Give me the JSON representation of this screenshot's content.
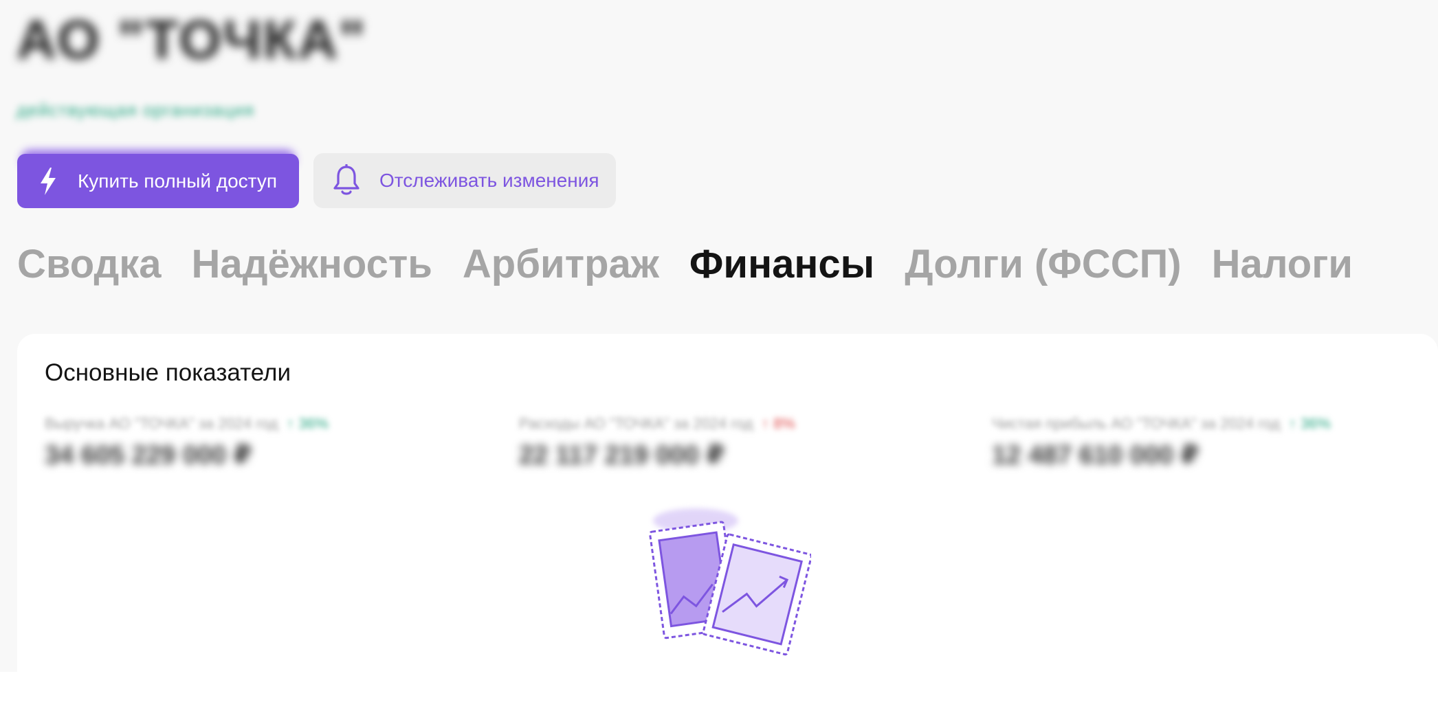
{
  "company": {
    "title": "АО \"ТОЧКА\"",
    "subtitle": "действующая организация"
  },
  "actions": {
    "buy_label": "Купить полный доступ",
    "buy_icon": "lightning-icon",
    "track_label": "Отслеживать изменения",
    "track_icon": "bell-icon"
  },
  "tabs": [
    {
      "label": "Сводка",
      "active": false
    },
    {
      "label": "Надёжность",
      "active": false
    },
    {
      "label": "Арбитраж",
      "active": false
    },
    {
      "label": "Финансы",
      "active": true
    },
    {
      "label": "Долги (ФССП)",
      "active": false
    },
    {
      "label": "Налоги",
      "active": false
    }
  ],
  "main": {
    "title": "Основные показатели",
    "metrics": [
      {
        "label": "Выручка АО \"ТОЧКА\" за 2024 год",
        "delta": "↑ 36%",
        "delta_color": "#2aa884",
        "value": "34 605 229 000 ₽"
      },
      {
        "label": "Расходы АО \"ТОЧКА\" за 2024 год",
        "delta": "↑ 8%",
        "delta_color": "#e05050",
        "value": "22 117 219 000 ₽"
      },
      {
        "label": "Чистая прибыль АО \"ТОЧКА\" за 2024 год",
        "delta": "↑ 36%",
        "delta_color": "#2aa884",
        "value": "12 487 610 000 ₽"
      }
    ]
  },
  "colors": {
    "accent": "#7d55e0",
    "accent_light": "#e6dcfb",
    "tab_inactive": "#a5a5a5",
    "tab_active": "#141414",
    "page_bg": "#f8f8f8"
  },
  "illustration_icon": "finance-chart-stamps-icon"
}
